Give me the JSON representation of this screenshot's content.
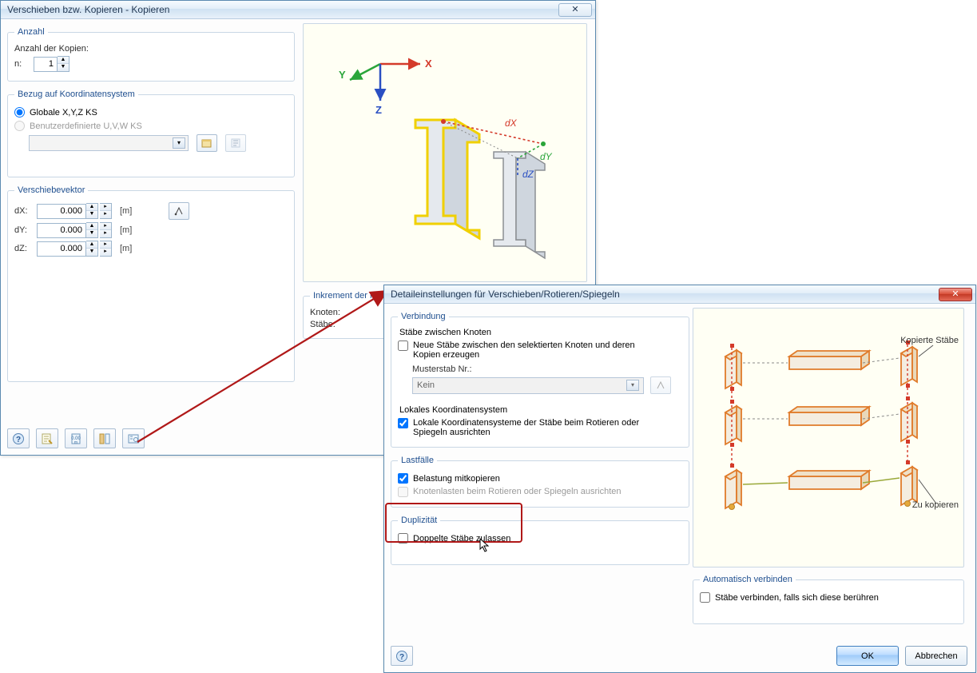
{
  "dialog1": {
    "title": "Verschieben bzw. Kopieren - Kopieren",
    "anzahl": {
      "legend": "Anzahl",
      "copies_label": "Anzahl der Kopien:",
      "n_label": "n:",
      "n_value": "1"
    },
    "ks": {
      "legend": "Bezug auf Koordinatensystem",
      "opt_global": "Globale X,Y,Z KS",
      "opt_user": "Benutzerdefinierte U,V,W KS"
    },
    "vek": {
      "legend": "Verschiebevektor",
      "dx_label": "dX:",
      "dy_label": "dY:",
      "dz_label": "dZ:",
      "dx_value": "0.000",
      "dy_value": "0.000",
      "dz_value": "0.000",
      "unit": "[m]"
    },
    "increment_label": "Inkrement der Nu",
    "knoten_label": "Knoten:",
    "staebe_label": "Stäbe:"
  },
  "preview1": {
    "x_label": "X",
    "y_label": "Y",
    "z_label": "Z",
    "dx": "dX",
    "dy": "dY",
    "dz": "dZ"
  },
  "dialog2": {
    "title": "Detaileinstellungen für Verschieben/Rotieren/Spiegeln",
    "verbindung": {
      "legend": "Verbindung",
      "sub1": "Stäbe zwischen Knoten",
      "chk1": "Neue Stäbe zwischen den selektierten Knoten und deren Kopien erzeugen",
      "muster_label": "Musterstab Nr.:",
      "muster_value": "Kein",
      "lks_head": "Lokales Koordinatensystem",
      "chk_lks": "Lokale Koordinatensysteme der Stäbe beim Rotieren oder Spiegeln ausrichten"
    },
    "lastfaelle": {
      "legend": "Lastfälle",
      "chk_copy_load": "Belastung mitkopieren",
      "chk_node_loads": "Knotenlasten beim Rotieren oder Spiegeln ausrichten"
    },
    "dup": {
      "legend": "Duplizität",
      "chk": "Doppelte Stäbe zulassen"
    },
    "auto": {
      "legend": "Automatisch verbinden",
      "chk": "Stäbe verbinden, falls sich diese berühren"
    },
    "ok": "OK",
    "cancel": "Abbrechen",
    "preview_top": "Kopierte Stäbe",
    "preview_bottom": "Zu kopieren"
  }
}
